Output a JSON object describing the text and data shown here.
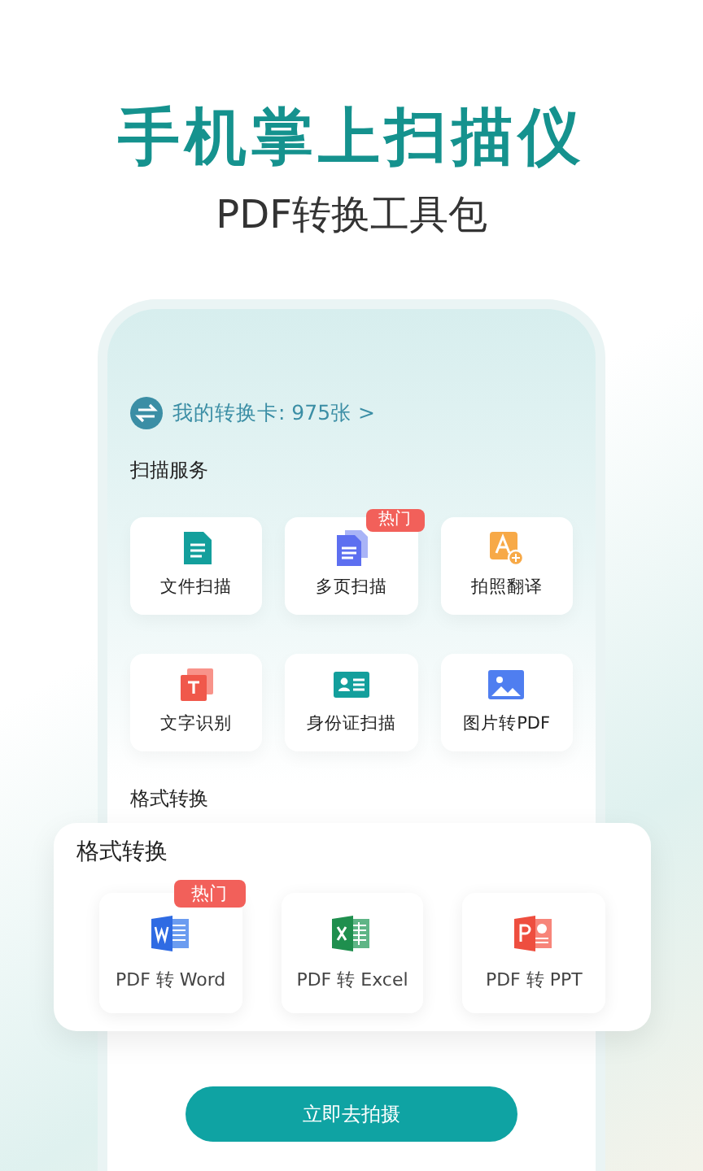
{
  "headline": "手机掌上扫描仪",
  "subtitle": "PDF转换工具包",
  "card_balance": "我的转换卡: 975张 >",
  "scan_section": {
    "title": "扫描服务",
    "tiles": [
      {
        "label": "文件扫描",
        "kind": "doc"
      },
      {
        "label": "多页扫描",
        "kind": "pages",
        "badge": "热门"
      },
      {
        "label": "拍照翻译",
        "kind": "translate"
      },
      {
        "label": "文字识别",
        "kind": "ocr"
      },
      {
        "label": "身份证扫描",
        "kind": "idcard"
      },
      {
        "label": "图片转PDF",
        "kind": "image"
      }
    ]
  },
  "format_section": {
    "title": "格式转换"
  },
  "popup": {
    "title": "格式转换",
    "tiles": [
      {
        "label": "PDF 转 Word",
        "kind": "word",
        "badge": "热门"
      },
      {
        "label": "PDF 转 Excel",
        "kind": "excel"
      },
      {
        "label": "PDF 转 PPT",
        "kind": "ppt"
      }
    ]
  },
  "action_button": "立即去拍摄"
}
